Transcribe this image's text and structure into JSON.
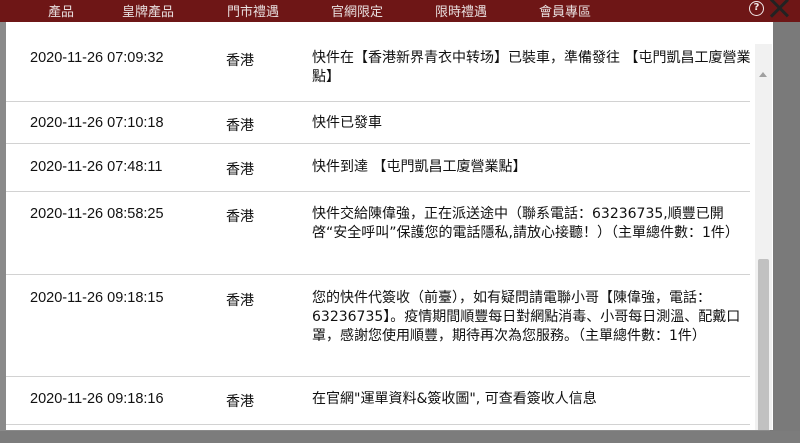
{
  "nav": {
    "items": [
      "產品",
      "皇牌產品",
      "門市禮遇",
      "官網限定",
      "限時禮遇",
      "會員專區"
    ]
  },
  "colors": {
    "nav_bg": "#6e1616",
    "overlay": "#8a8a8a",
    "modal_bg": "#ffffff"
  },
  "icons": {
    "help": "help-icon",
    "close": "close-icon"
  },
  "help_label": "?",
  "tracking": [
    {
      "time": "2020-11-26 07:09:32",
      "location": "香港",
      "description": "快件在【香港新界青衣中转场】已裝車，準備發往 【屯門凱昌工廈營業點】"
    },
    {
      "time": "2020-11-26 07:10:18",
      "location": "香港",
      "description": "快件已發車"
    },
    {
      "time": "2020-11-26 07:48:11",
      "location": "香港",
      "description": "快件到達 【屯門凱昌工廈營業點】"
    },
    {
      "time": "2020-11-26 08:58:25",
      "location": "香港",
      "description": "快件交給陳偉強，正在派送途中（聯系電話：63236735,順豐已開啓“安全呼叫”保護您的電話隱私,請放心接聽！）（主單總件數：1件）"
    },
    {
      "time": "2020-11-26 09:18:15",
      "location": "香港",
      "description": "您的快件代簽收（前臺），如有疑問請電聯小哥【陳偉強，電話：63236735】。疫情期間順豐每日對網點消毒、小哥每日測溫、配戴口罩，感謝您使用順豐，期待再次為您服務。（主單總件數：1件）"
    },
    {
      "time": "2020-11-26 09:18:16",
      "location": "香港",
      "description": "在官網\"運單資料&簽收圖\", 可查看簽收人信息"
    }
  ]
}
